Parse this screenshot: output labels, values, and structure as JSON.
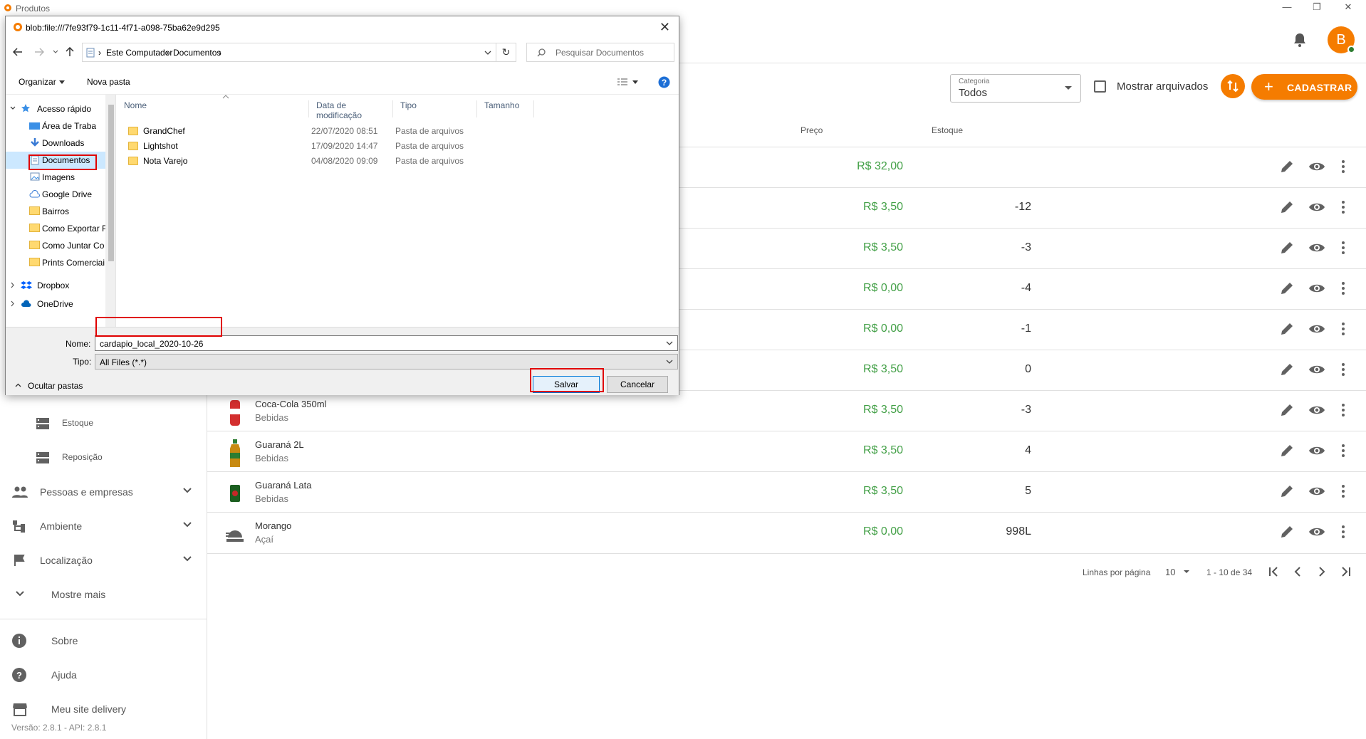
{
  "app": {
    "title": "Produtos",
    "avatar_letter": "B"
  },
  "toolbar": {
    "category_label": "Categoria",
    "category_value": "Todos",
    "show_archived_label": "Mostrar arquivados",
    "add_label": "CADASTRAR"
  },
  "table": {
    "headers": {
      "price": "Preço",
      "stock": "Estoque"
    },
    "rows": [
      {
        "name": "",
        "category": "",
        "price": "R$ 32,00",
        "stock": ""
      },
      {
        "name": "",
        "category": "",
        "price": "R$ 3,50",
        "stock": "-12"
      },
      {
        "name": "",
        "category": "",
        "price": "R$ 3,50",
        "stock": "-3"
      },
      {
        "name": "",
        "category": "",
        "price": "R$ 0,00",
        "stock": "-4"
      },
      {
        "name": "",
        "category": "",
        "price": "R$ 0,00",
        "stock": "-1"
      },
      {
        "name": "",
        "category": "",
        "price": "R$ 3,50",
        "stock": "0"
      },
      {
        "name": "Coca-Cola 350ml",
        "category": "Bebidas",
        "price": "R$ 3,50",
        "stock": "-3"
      },
      {
        "name": "Guaraná 2L",
        "category": "Bebidas",
        "price": "R$ 3,50",
        "stock": "4"
      },
      {
        "name": "Guaraná Lata",
        "category": "Bebidas",
        "price": "R$ 3,50",
        "stock": "5"
      },
      {
        "name": "Morango",
        "category": "Açaí",
        "price": "R$ 0,00",
        "stock": "998L"
      }
    ]
  },
  "pagination": {
    "rows_per_page_label": "Linhas por página",
    "rows_per_page": "10",
    "range": "1 - 10 de 34"
  },
  "sidebar": {
    "items": [
      {
        "label": "Estoque"
      },
      {
        "label": "Reposição"
      },
      {
        "label": "Pessoas e empresas"
      },
      {
        "label": "Ambiente"
      },
      {
        "label": "Localização"
      },
      {
        "label": "Mostre mais"
      },
      {
        "label": "Sobre"
      },
      {
        "label": "Ajuda"
      },
      {
        "label": "Meu site delivery"
      }
    ],
    "version": "Versão: 2.8.1 - API: 2.8.1"
  },
  "dialog": {
    "title": "blob:file:///7fe93f79-1c11-4f71-a098-75ba62e9d295",
    "breadcrumb": [
      "Este Computador",
      "Documentos"
    ],
    "search_placeholder": "Pesquisar Documentos",
    "organize_label": "Organizar",
    "new_folder_label": "Nova pasta",
    "nav_items": [
      {
        "label": "Acesso rápido"
      },
      {
        "label": "Área de Traba"
      },
      {
        "label": "Downloads"
      },
      {
        "label": "Documentos"
      },
      {
        "label": "Imagens"
      },
      {
        "label": "Google Drive"
      },
      {
        "label": "Bairros"
      },
      {
        "label": "Como Exportar P"
      },
      {
        "label": "Como Juntar Co"
      },
      {
        "label": "Prints Comerciai"
      },
      {
        "label": "Dropbox"
      },
      {
        "label": "OneDrive"
      }
    ],
    "columns": {
      "name": "Nome",
      "date": "Data de modificação",
      "type": "Tipo",
      "size": "Tamanho"
    },
    "files": [
      {
        "name": "GrandChef",
        "date": "22/07/2020 08:51",
        "type": "Pasta de arquivos"
      },
      {
        "name": "Lightshot",
        "date": "17/09/2020 14:47",
        "type": "Pasta de arquivos"
      },
      {
        "name": "Nota Varejo",
        "date": "04/08/2020 09:09",
        "type": "Pasta de arquivos"
      }
    ],
    "filename_label": "Nome:",
    "filename_value": "cardapio_local_2020-10-26",
    "filetype_label": "Tipo:",
    "filetype_value": "All Files (*.*)",
    "hide_folders_label": "Ocultar pastas",
    "save_label": "Salvar",
    "cancel_label": "Cancelar"
  },
  "colors": {
    "accent": "#f57c00",
    "price_green": "#43a047",
    "highlight_red": "#e00000"
  }
}
